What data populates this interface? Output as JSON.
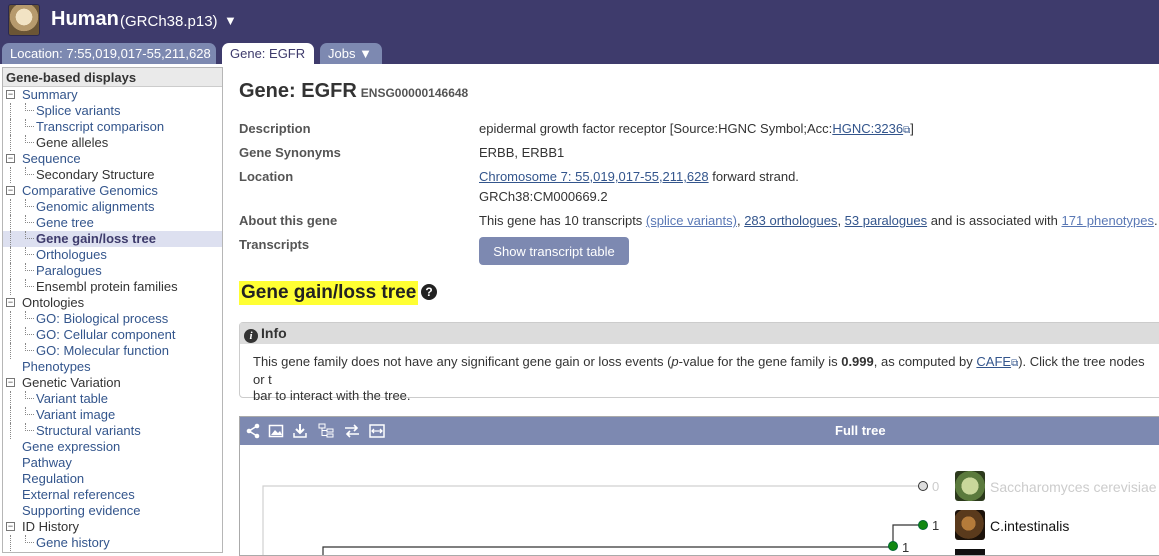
{
  "header": {
    "species": "Human",
    "assembly": "(GRCh38.p13)",
    "dropdown_glyph": "▼",
    "tabs": [
      {
        "label": "Location: 7:55,019,017-55,211,628"
      },
      {
        "label": "Gene: EGFR"
      },
      {
        "label": "Jobs ▼"
      }
    ]
  },
  "sidebar": {
    "header": "Gene-based displays",
    "items": [
      {
        "label": "Summary",
        "level": 0,
        "expander": "-"
      },
      {
        "label": "Splice variants",
        "level": 1
      },
      {
        "label": "Transcript comparison",
        "level": 1
      },
      {
        "label": "Gene alleles",
        "level": 1,
        "plain": true
      },
      {
        "label": "Sequence",
        "level": 0,
        "expander": "-"
      },
      {
        "label": "Secondary Structure",
        "level": 1,
        "plain": true
      },
      {
        "label": "Comparative Genomics",
        "level": 0,
        "expander": "-"
      },
      {
        "label": "Genomic alignments",
        "level": 1
      },
      {
        "label": "Gene tree",
        "level": 1
      },
      {
        "label": "Gene gain/loss tree",
        "level": 1,
        "current": true
      },
      {
        "label": "Orthologues",
        "level": 1
      },
      {
        "label": "Paralogues",
        "level": 1
      },
      {
        "label": "Ensembl protein families",
        "level": 1,
        "plain": true
      },
      {
        "label": "Ontologies",
        "level": 0,
        "expander": "-",
        "plain": true
      },
      {
        "label": "GO: Biological process",
        "level": 1
      },
      {
        "label": "GO: Cellular component",
        "level": 1
      },
      {
        "label": "GO: Molecular function",
        "level": 1
      },
      {
        "label": "Phenotypes",
        "level": 0
      },
      {
        "label": "Genetic Variation",
        "level": 0,
        "expander": "-",
        "plain": true
      },
      {
        "label": "Variant table",
        "level": 1
      },
      {
        "label": "Variant image",
        "level": 1
      },
      {
        "label": "Structural variants",
        "level": 1
      },
      {
        "label": "Gene expression",
        "level": 0
      },
      {
        "label": "Pathway",
        "level": 0
      },
      {
        "label": "Regulation",
        "level": 0
      },
      {
        "label": "External references",
        "level": 0
      },
      {
        "label": "Supporting evidence",
        "level": 0
      },
      {
        "label": "ID History",
        "level": 0,
        "expander": "-",
        "plain": true
      },
      {
        "label": "Gene history",
        "level": 1
      }
    ]
  },
  "main": {
    "gene_title": "Gene: EGFR",
    "gene_id": "ENSG00000146648",
    "summary": {
      "description_label": "Description",
      "description_text": "epidermal growth factor receptor [Source:HGNC Symbol;Acc:",
      "description_link": "HGNC:3236",
      "description_end": "]",
      "synonyms_label": "Gene Synonyms",
      "synonyms": "ERBB, ERBB1",
      "location_label": "Location",
      "location_link": "Chromosome 7: 55,019,017-55,211,628",
      "location_strand": " forward strand.",
      "location_assembly": "GRCh38:CM000669.2",
      "about_label": "About this gene",
      "about_text1": "This gene has 10 transcripts ",
      "about_link1": "(splice variants)",
      "about_sep1": ", ",
      "about_link2": "283 orthologues",
      "about_sep2": ", ",
      "about_link3": "53 paralogues",
      "about_text2": " and is associated with ",
      "about_link4": "171 phenotypes",
      "about_end": ".",
      "transcripts_label": "Transcripts",
      "transcripts_button": "Show transcript table"
    },
    "section_title": "Gene gain/loss tree",
    "info": {
      "title": "Info",
      "text_a": "This gene family does not have any significant gene gain or loss events (",
      "text_p": "p",
      "text_b": "-value for the gene family is ",
      "pvalue": "0.999",
      "text_c": ", as computed by ",
      "cafe_link": "CAFE",
      "text_d": "). Click the tree nodes or t",
      "text_e": "bar to interact with the tree."
    },
    "tree": {
      "title": "Full tree",
      "toolbar_icons": [
        "share-icon",
        "image-icon",
        "download-icon",
        "tree-layout-icon",
        "swap-icon",
        "resize-icon"
      ],
      "nodes": [
        {
          "count": "0",
          "species": "Saccharomyces cerevisiae",
          "greyed": true
        },
        {
          "count": "1",
          "species": "C.intestinalis",
          "greyed": false
        },
        {
          "count": "1"
        }
      ]
    }
  }
}
